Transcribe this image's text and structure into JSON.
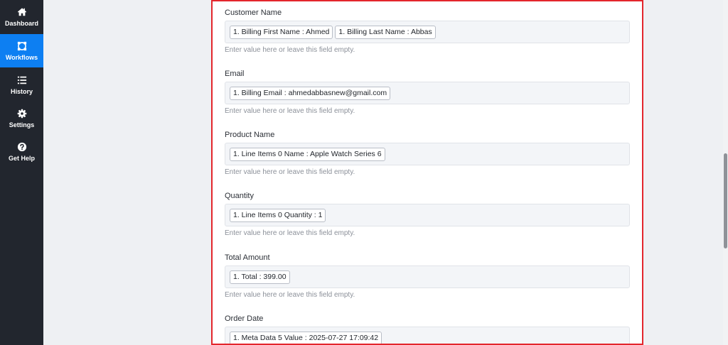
{
  "sidebar": {
    "items": [
      {
        "label": "Dashboard",
        "icon": "home-icon"
      },
      {
        "label": "Workflows",
        "icon": "workflow-icon",
        "active": true
      },
      {
        "label": "History",
        "icon": "list-icon"
      },
      {
        "label": "Settings",
        "icon": "gear-icon"
      },
      {
        "label": "Get Help",
        "icon": "help-icon"
      }
    ]
  },
  "form": {
    "helper_text": "Enter value here or leave this field empty.",
    "fields": [
      {
        "label": "Customer Name",
        "chips": [
          "1. Billing First Name : Ahmed",
          "1. Billing Last Name : Abbas"
        ]
      },
      {
        "label": "Email",
        "chips": [
          "1. Billing Email : ahmedabbasnew@gmail.com"
        ]
      },
      {
        "label": "Product Name",
        "chips": [
          "1. Line Items 0 Name : Apple Watch Series 6"
        ]
      },
      {
        "label": "Quantity",
        "chips": [
          "1. Line Items 0 Quantity : 1"
        ]
      },
      {
        "label": "Total Amount",
        "chips": [
          "1. Total : 399.00"
        ]
      },
      {
        "label": "Order Date",
        "chips": [
          "1. Meta Data 5 Value : 2025-07-27 17:09:42"
        ]
      }
    ]
  },
  "colors": {
    "sidebar_bg": "#22262e",
    "active_bg": "#0d7ff2",
    "panel_border": "#e3262c"
  }
}
